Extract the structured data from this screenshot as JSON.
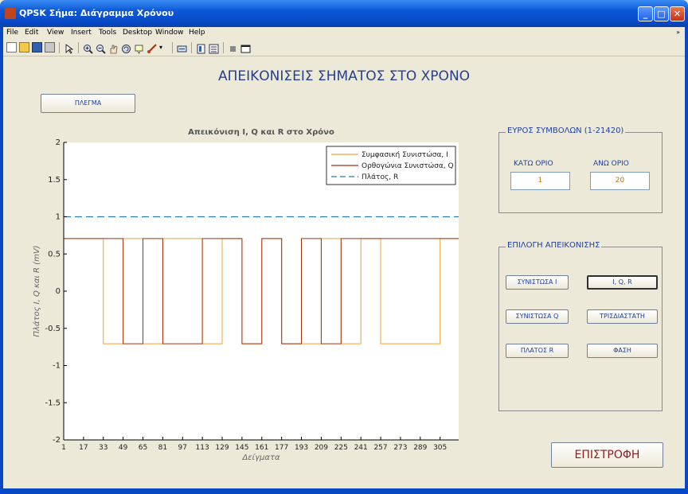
{
  "window": {
    "title": "QPSK Σήμα: Διάγραμμα Χρόνου"
  },
  "menu": [
    "File",
    "Edit",
    "View",
    "Insert",
    "Tools",
    "Desktop",
    "Window",
    "Help"
  ],
  "toolbar": [
    "new-icon",
    "open-icon",
    "save-icon",
    "print-icon",
    "pointer-icon",
    "zoom-in-icon",
    "zoom-out-icon",
    "pan-icon",
    "rotate-icon",
    "datacursor-icon",
    "brush-icon",
    "link-icon",
    "colorbar-icon",
    "legend-icon",
    "hide-tools-icon",
    "dock-icon"
  ],
  "heading": "ΑΠΕΙΚΟΝΙΣΕΙΣ ΣΗΜΑΤΟΣ ΣΤΟ ΧΡΟΝΟ",
  "grid_button": "ΠΛΕΓΜΑ",
  "range_panel": {
    "title": "ΕΥΡΟΣ ΣΥΜΒΟΛΩΝ (1-21420)",
    "lower_label": "ΚΑΤΩ ΟΡΙΟ",
    "upper_label": "ΑΝΩ ΟΡΙΟ",
    "lower_value": "1",
    "upper_value": "20"
  },
  "display_panel": {
    "title": "ΕΠΙΛΟΓΗ ΑΠΕΙΚΟΝΙΣΗΣ",
    "buttons": [
      "ΣΥΝΙΣΤΩΣΑ Ι",
      "Ι, Q, R",
      "ΣΥΝΙΣΤΩΣΑ Q",
      "ΤΡΙΣΔΙΑΣΤΑΤΗ",
      "ΠΛΑΤΟΣ R",
      "ΦΑΣΗ"
    ]
  },
  "return_button": "ΕΠΙΣΤΡΟΦΗ",
  "chart_data": {
    "type": "line",
    "title": "Απεικόνιση I, Q και R στο Χρόνο",
    "xlabel": "Δείγματα",
    "ylabel": "Πλάτος I, Q και R (mV)",
    "xlim": [
      1,
      320
    ],
    "ylim": [
      -2,
      2
    ],
    "xticks": [
      1,
      17,
      33,
      49,
      65,
      81,
      97,
      113,
      129,
      145,
      161,
      177,
      193,
      209,
      225,
      241,
      257,
      273,
      289,
      305
    ],
    "yticks": [
      2,
      1.5,
      1,
      0.5,
      0,
      -0.5,
      -1,
      -1.5,
      -2
    ],
    "ytick_labels": [
      "2",
      "1.5",
      "1",
      "0.5",
      "0",
      "-0.5",
      "-1",
      "-1.5",
      "-2"
    ],
    "grid": false,
    "legend_position": "top-right",
    "series": [
      {
        "name": "Συμφασική Συνιστώσα, I",
        "color": "#f0a030",
        "style": "solid",
        "x": [
          1,
          33,
          33,
          49,
          49,
          65,
          65,
          81,
          81,
          113,
          113,
          129,
          129,
          145,
          145,
          161,
          161,
          177,
          177,
          209,
          209,
          225,
          225,
          241,
          241,
          257,
          257,
          305,
          305,
          320
        ],
        "y": [
          0.707,
          0.707,
          -0.707,
          -0.707,
          0.707,
          0.707,
          -0.707,
          -0.707,
          0.707,
          0.707,
          -0.707,
          -0.707,
          0.707,
          0.707,
          -0.707,
          -0.707,
          0.707,
          0.707,
          -0.707,
          -0.707,
          0.707,
          0.707,
          -0.707,
          -0.707,
          0.707,
          0.707,
          -0.707,
          -0.707,
          0.707,
          0.707
        ]
      },
      {
        "name": "Ορθογώνια Συνιστώσα, Q",
        "color": "#a83010",
        "style": "solid",
        "x": [
          1,
          49,
          49,
          65,
          65,
          81,
          81,
          113,
          113,
          145,
          145,
          161,
          161,
          177,
          177,
          193,
          193,
          209,
          209,
          225,
          225,
          320
        ],
        "y": [
          0.707,
          0.707,
          -0.707,
          -0.707,
          0.707,
          0.707,
          -0.707,
          -0.707,
          0.707,
          0.707,
          -0.707,
          -0.707,
          0.707,
          0.707,
          -0.707,
          -0.707,
          0.707,
          0.707,
          -0.707,
          -0.707,
          0.707,
          0.707
        ]
      },
      {
        "name": "Πλάτος, R",
        "color": "#2a7ab0",
        "style": "dashed",
        "x": [
          1,
          320
        ],
        "y": [
          1,
          1
        ]
      }
    ]
  }
}
